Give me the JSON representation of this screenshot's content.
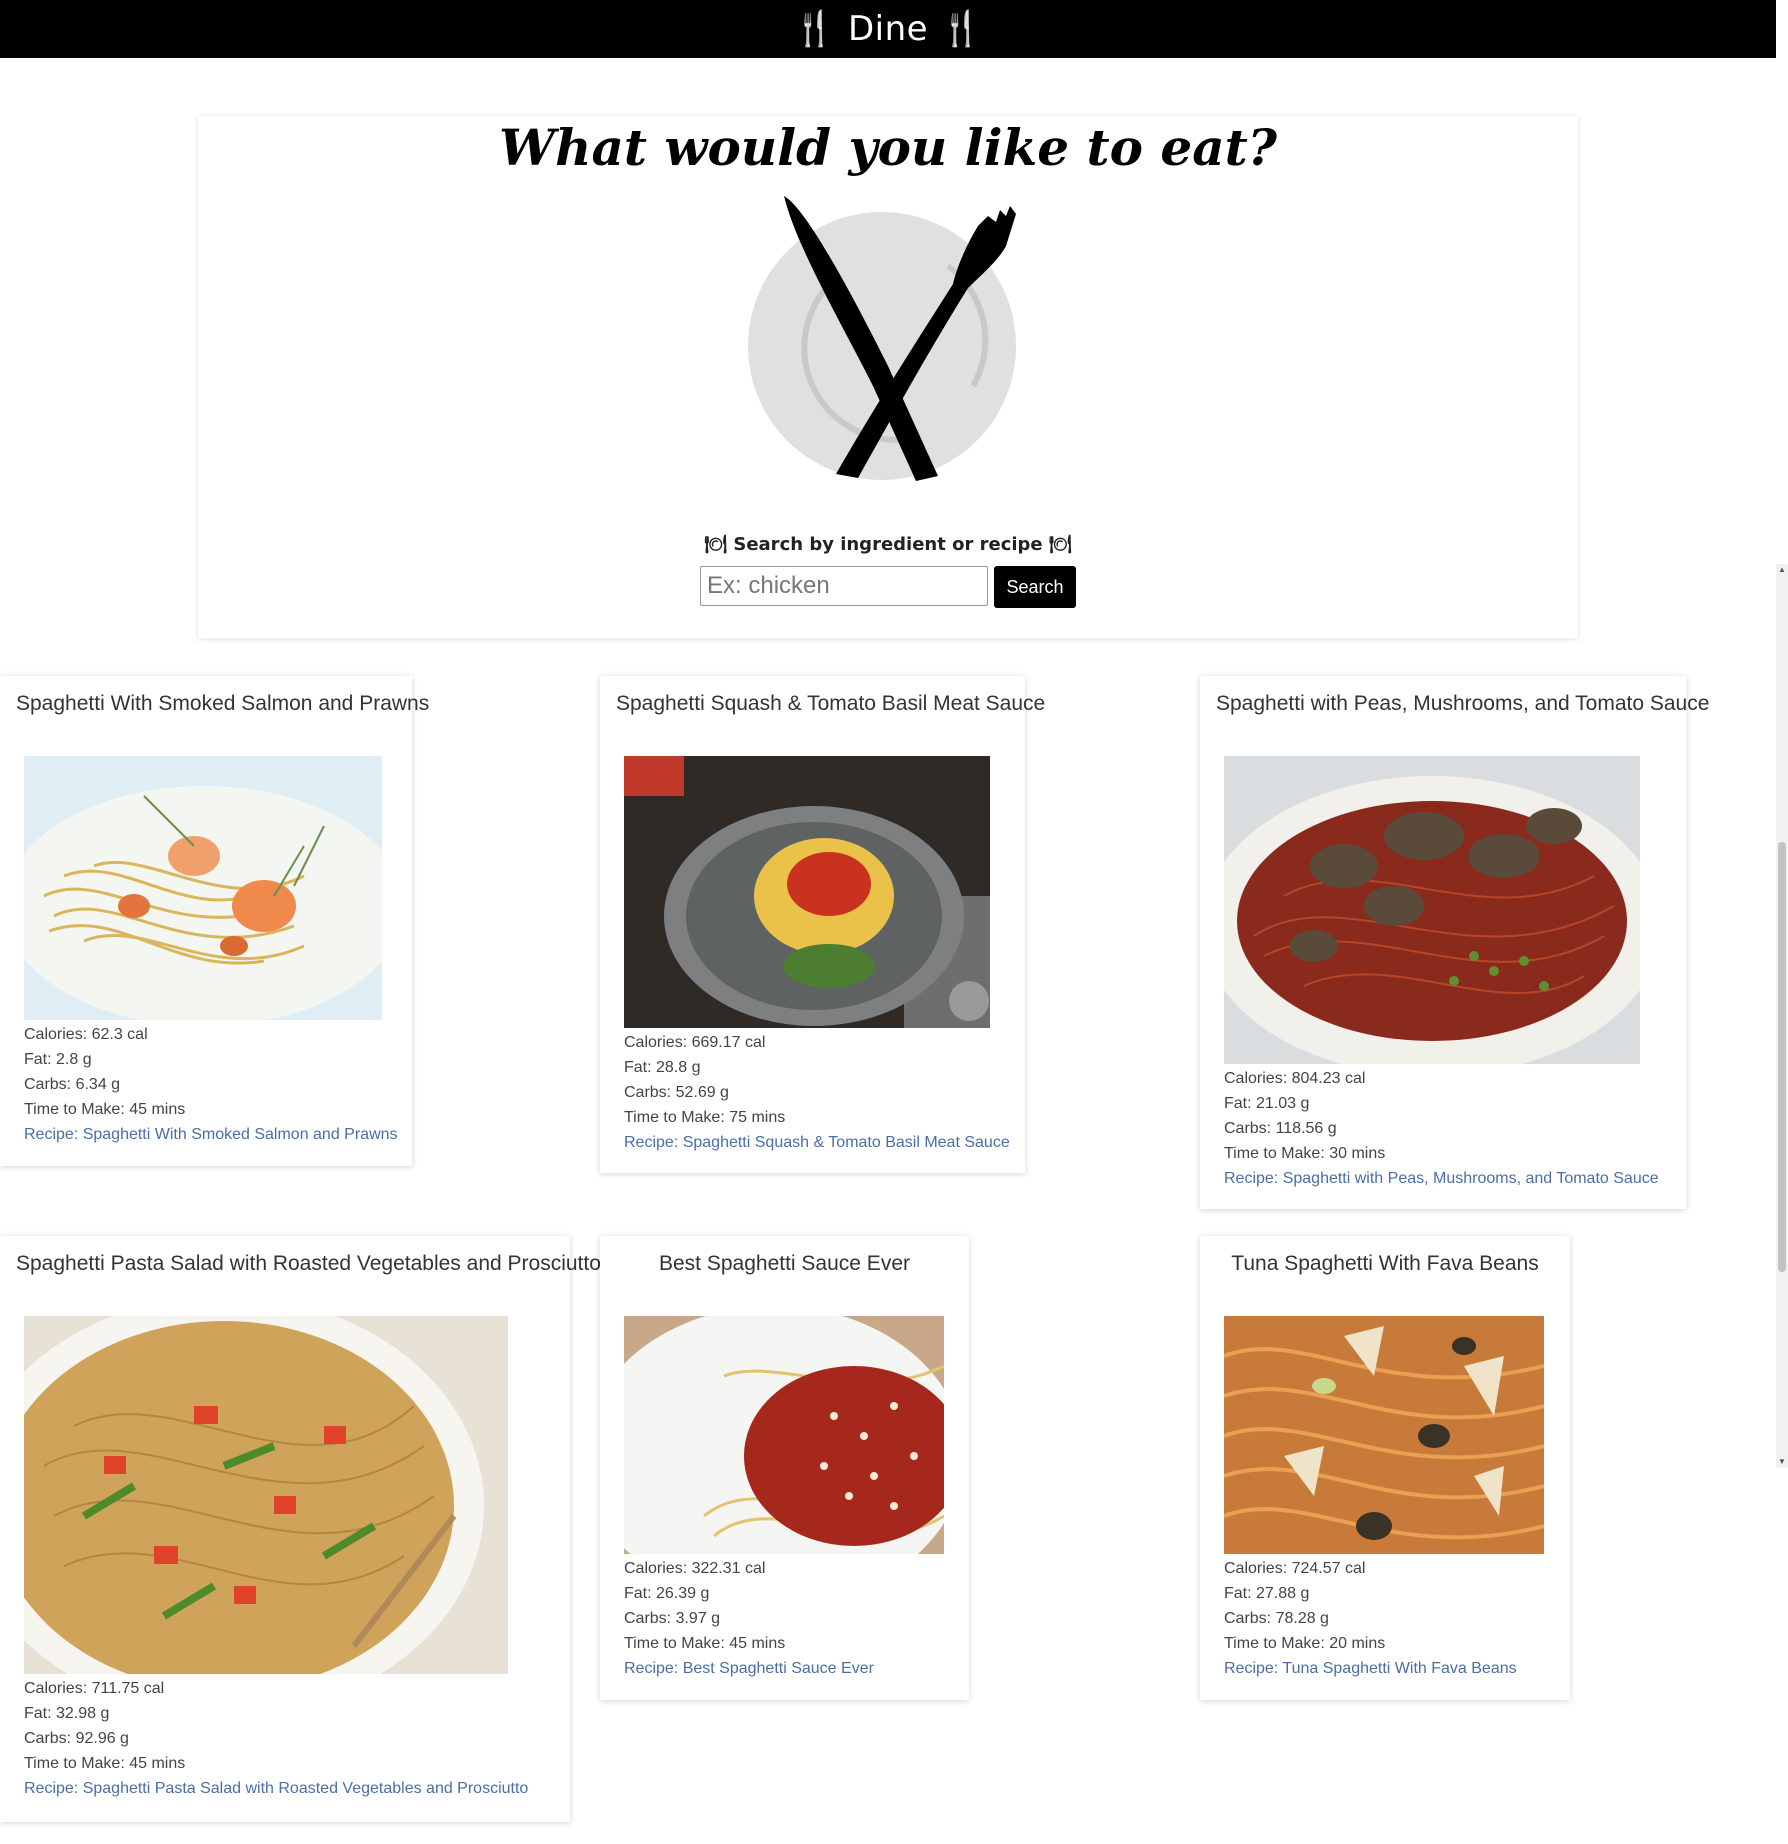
{
  "app": {
    "brand": "Dine",
    "brand_icon": "fork-knife-icon"
  },
  "hero": {
    "heading": "What would you like to eat?",
    "search_label": "🍽 Search by ingredient or recipe 🍽",
    "search_placeholder": "Ex: chicken",
    "search_value": "",
    "search_button": "Search"
  },
  "colors": {
    "topbar": "#000000",
    "link": "#4a6ea8",
    "button": "#000000"
  },
  "recipes": [
    {
      "title": "Spaghetti With Smoked Salmon and Prawns",
      "calories": "Calories: 62.3 cal",
      "fat": "Fat: 2.8 g",
      "carbs": "Carbs: 6.34 g",
      "time": "Time to Make: 45 mins",
      "link": "Recipe: Spaghetti With Smoked Salmon and Prawns"
    },
    {
      "title": "Spaghetti Squash & Tomato Basil Meat Sauce",
      "calories": "Calories: 669.17 cal",
      "fat": "Fat: 28.8 g",
      "carbs": "Carbs: 52.69 g",
      "time": "Time to Make: 75 mins",
      "link": "Recipe: Spaghetti Squash & Tomato Basil Meat Sauce"
    },
    {
      "title": "Spaghetti with Peas, Mushrooms, and Tomato Sauce",
      "calories": "Calories: 804.23 cal",
      "fat": "Fat: 21.03 g",
      "carbs": "Carbs: 118.56 g",
      "time": "Time to Make: 30 mins",
      "link": "Recipe: Spaghetti with Peas, Mushrooms, and Tomato Sauce"
    },
    {
      "title": "Spaghetti Pasta Salad with Roasted Vegetables and Prosciutto",
      "calories": "Calories: 711.75 cal",
      "fat": "Fat: 32.98 g",
      "carbs": "Carbs: 92.96 g",
      "time": "Time to Make: 45 mins",
      "link": "Recipe: Spaghetti Pasta Salad with Roasted Vegetables and Prosciutto"
    },
    {
      "title": "Best Spaghetti Sauce Ever",
      "calories": "Calories: 322.31 cal",
      "fat": "Fat: 26.39 g",
      "carbs": "Carbs: 3.97 g",
      "time": "Time to Make: 45 mins",
      "link": "Recipe: Best Spaghetti Sauce Ever"
    },
    {
      "title": "Tuna Spaghetti With Fava Beans",
      "calories": "Calories: 724.57 cal",
      "fat": "Fat: 27.88 g",
      "carbs": "Carbs: 78.28 g",
      "time": "Time to Make: 20 mins",
      "link": "Recipe: Tuna Spaghetti With Fava Beans"
    }
  ]
}
